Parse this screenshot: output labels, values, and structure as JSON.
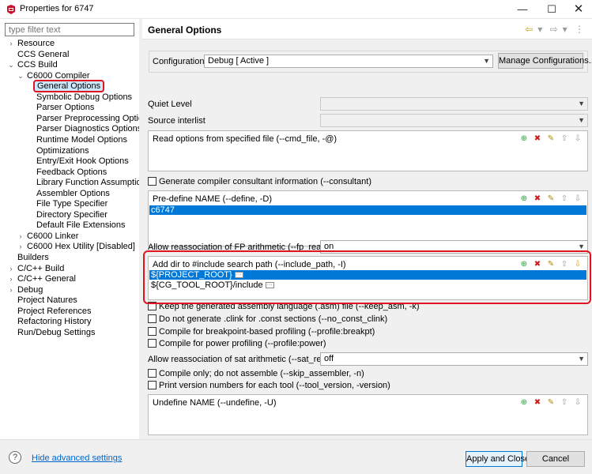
{
  "window": {
    "title": "Properties for 6747",
    "min_glyph": "—",
    "max_glyph": "☐",
    "close_glyph": "✕"
  },
  "filter": {
    "placeholder": "type filter text"
  },
  "tree": {
    "expand_glyph": "⌄",
    "collapse_glyph": "›",
    "items": [
      {
        "label": "Resource",
        "twisty": ">"
      },
      {
        "label": "CCS General",
        "twisty": ""
      },
      {
        "label": "CCS Build",
        "twisty": "v"
      },
      {
        "label": "C6000 Compiler",
        "twisty": "v"
      },
      {
        "label": "General Options",
        "twisty": "",
        "selected": true
      },
      {
        "label": "Symbolic Debug Options",
        "twisty": ""
      },
      {
        "label": "Parser Options",
        "twisty": ""
      },
      {
        "label": "Parser Preprocessing Options",
        "twisty": ""
      },
      {
        "label": "Parser Diagnostics Options",
        "twisty": ""
      },
      {
        "label": "Runtime Model Options",
        "twisty": ""
      },
      {
        "label": "Optimizations",
        "twisty": ""
      },
      {
        "label": "Entry/Exit Hook Options",
        "twisty": ""
      },
      {
        "label": "Feedback Options",
        "twisty": ""
      },
      {
        "label": "Library Function Assumptions",
        "twisty": ""
      },
      {
        "label": "Assembler Options",
        "twisty": ""
      },
      {
        "label": "File Type Specifier",
        "twisty": ""
      },
      {
        "label": "Directory Specifier",
        "twisty": ""
      },
      {
        "label": "Default File Extensions",
        "twisty": ""
      },
      {
        "label": "C6000 Linker",
        "twisty": ">"
      },
      {
        "label": "C6000 Hex Utility  [Disabled]",
        "twisty": ">"
      },
      {
        "label": "Builders",
        "twisty": ""
      },
      {
        "label": "C/C++ Build",
        "twisty": ">"
      },
      {
        "label": "C/C++ General",
        "twisty": ">"
      },
      {
        "label": "Debug",
        "twisty": ">"
      },
      {
        "label": "Project Natures",
        "twisty": ""
      },
      {
        "label": "Project References",
        "twisty": ""
      },
      {
        "label": "Refactoring History",
        "twisty": ""
      },
      {
        "label": "Run/Debug Settings",
        "twisty": ""
      }
    ]
  },
  "panel": {
    "title": "General Options",
    "nav": {
      "back": "⇦",
      "back_menu": "▾",
      "forward": "⇨",
      "forward_menu": "▾",
      "more": "⋮"
    },
    "configuration": {
      "label": "Configuration:",
      "value": "Debug  [ Active ]",
      "manage_label": "Manage Configurations..."
    },
    "quiet_level": {
      "label": "Quiet Level",
      "value": ""
    },
    "source_interlist": {
      "label": "Source interlist",
      "value": ""
    },
    "cmd_file": {
      "title": "Read options from specified file (--cmd_file, -@)"
    },
    "consultant": {
      "label": "Generate compiler consultant information (--consultant)",
      "checked": false
    },
    "define": {
      "title": "Pre-define NAME (--define, -D)",
      "items": [
        "c6747"
      ]
    },
    "fp_reassoc": {
      "label": "Allow reassociation of FP arithmetic (--fp_reassoc)",
      "value": "on"
    },
    "include_path": {
      "title": "Add dir to #include search path (--include_path, -I)",
      "items": [
        "${PROJECT_ROOT}",
        "${CG_TOOL_ROOT}/include"
      ],
      "ellipsis": "···"
    },
    "checks": [
      {
        "label": "Keep the generated assembly language (.asm) file (--keep_asm, -k)",
        "checked": false
      },
      {
        "label": "Do not generate .clink for .const sections (--no_const_clink)",
        "checked": false
      },
      {
        "label": "Compile for breakpoint-based profiling (--profile:breakpt)",
        "checked": false
      },
      {
        "label": "Compile for power profiling (--profile:power)",
        "checked": false
      }
    ],
    "sat_reassoc": {
      "label": "Allow reassociation of sat arithmetic (--sat_reassoc)",
      "value": "off"
    },
    "checks2": [
      {
        "label": "Compile only; do not assemble (--skip_assembler, -n)",
        "checked": false
      },
      {
        "label": "Print version numbers for each tool (--tool_version, -version)",
        "checked": false
      }
    ],
    "undefine": {
      "title": "Undefine NAME (--undefine, -U)"
    },
    "tools": {
      "add": "⊕",
      "delete": "✖",
      "edit": "✎",
      "up": "⇧",
      "down": "⇩"
    }
  },
  "footer": {
    "help_glyph": "?",
    "hide_advanced": "Hide advanced settings",
    "apply_close": "Apply and Close",
    "cancel": "Cancel"
  },
  "colors": {
    "accent_red": "#e0141e",
    "selection_blue": "#0078d7"
  }
}
